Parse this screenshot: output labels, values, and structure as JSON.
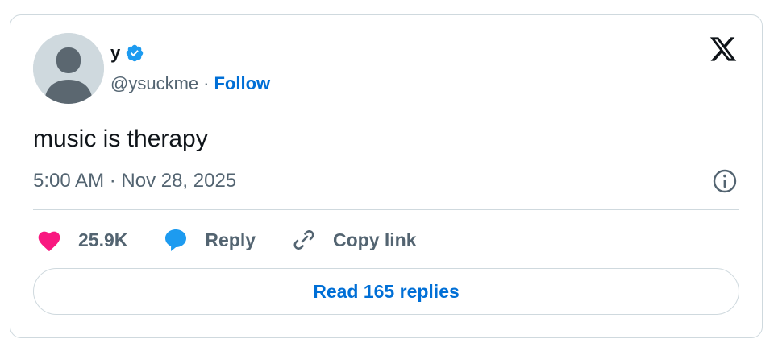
{
  "tweet": {
    "author": {
      "display_name": "y",
      "handle": "@ysuckme",
      "separator": "·",
      "follow_label": "Follow",
      "verified": true
    },
    "text": "music is therapy",
    "timestamp": "5:00 AM · Nov 28, 2025"
  },
  "actions": {
    "like_count": "25.9K",
    "reply_label": "Reply",
    "copy_link_label": "Copy link"
  },
  "footer": {
    "read_replies_label": "Read 165 replies"
  },
  "icons": {
    "platform_logo": "x-logo-icon",
    "verified": "verified-badge-icon",
    "info": "info-icon",
    "like": "heart-icon",
    "reply": "speech-bubble-icon",
    "copy_link": "link-icon"
  },
  "colors": {
    "link_blue": "#006fd6",
    "verified_blue": "#1d9bf0",
    "heart_pink": "#f91880",
    "secondary_text": "#536471",
    "border": "#cfd9de"
  }
}
